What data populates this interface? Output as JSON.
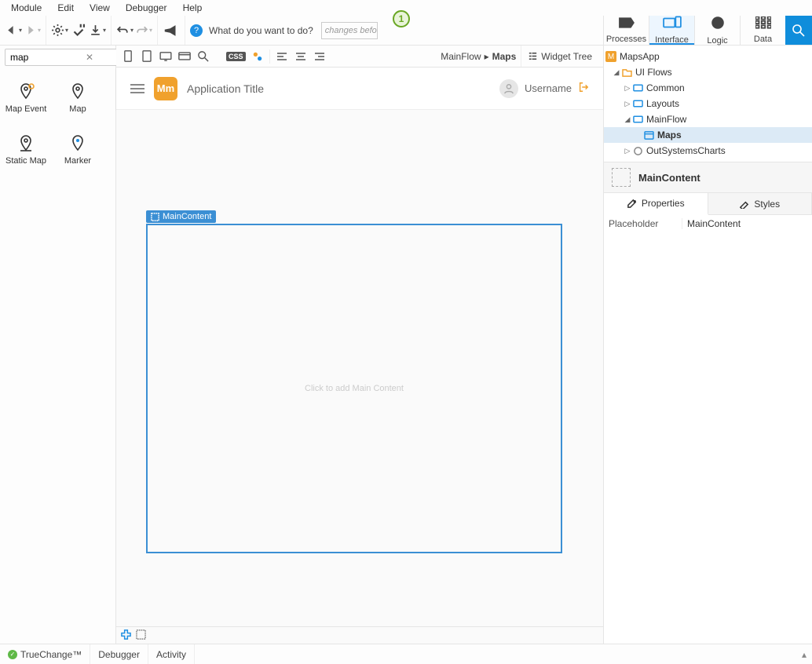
{
  "menu": {
    "module": "Module",
    "edit": "Edit",
    "view": "View",
    "debugger": "Debugger",
    "help": "Help"
  },
  "toolbar": {
    "help_prompt": "What do you want to do?",
    "changes_hint": "changes befo",
    "notif_count": "1",
    "tabs": {
      "processes": "Processes",
      "interface": "Interface",
      "logic": "Logic",
      "data": "Data"
    }
  },
  "toolbox": {
    "search_value": "map",
    "items": [
      {
        "label": "Map Event"
      },
      {
        "label": "Map"
      },
      {
        "label": "Static Map"
      },
      {
        "label": "Marker"
      }
    ]
  },
  "canvas": {
    "breadcrumb_root": "MainFlow",
    "breadcrumb_current": "Maps",
    "widget_tree": "Widget Tree",
    "app_title": "Application Title",
    "app_logo": "Mm",
    "username": "Username",
    "placeholder_tag": "MainContent",
    "placeholder_hint": "Click to add Main Content"
  },
  "tree": {
    "root": "MapsApp",
    "uiflows": "UI Flows",
    "common": "Common",
    "layouts": "Layouts",
    "mainflow": "MainFlow",
    "maps": "Maps",
    "charts": "OutSystemsCharts"
  },
  "selection": {
    "name": "MainContent"
  },
  "prop_tabs": {
    "properties": "Properties",
    "styles": "Styles"
  },
  "props": {
    "key": "Placeholder",
    "val": "MainContent"
  },
  "bottom": {
    "truechange": "TrueChange™",
    "debugger": "Debugger",
    "activity": "Activity"
  }
}
